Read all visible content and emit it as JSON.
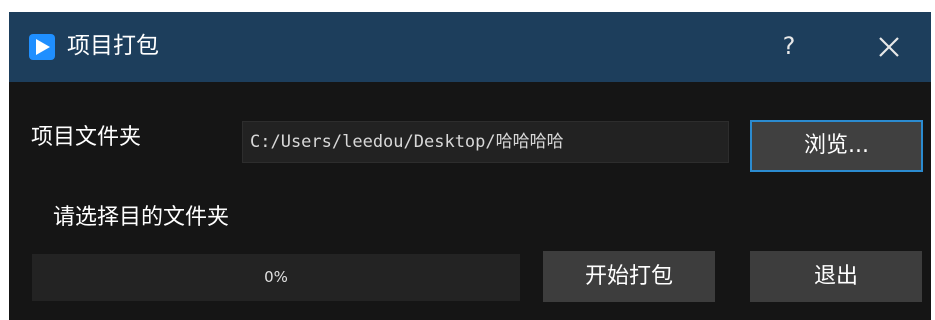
{
  "window": {
    "title": "项目打包",
    "help_label": "?",
    "accent_color": "#1f8fff",
    "titlebar_color": "#1d3e5c"
  },
  "form": {
    "folder_label": "项目文件夹",
    "folder_path": "C:/Users/leedou/Desktop/哈哈哈哈",
    "browse_label": "浏览..."
  },
  "status": {
    "message": "请选择目的文件夹",
    "progress_text": "0%",
    "progress_percent": 0
  },
  "actions": {
    "start_label": "开始打包",
    "exit_label": "退出"
  },
  "icons": {
    "app": "play-icon",
    "close": "close-icon"
  }
}
